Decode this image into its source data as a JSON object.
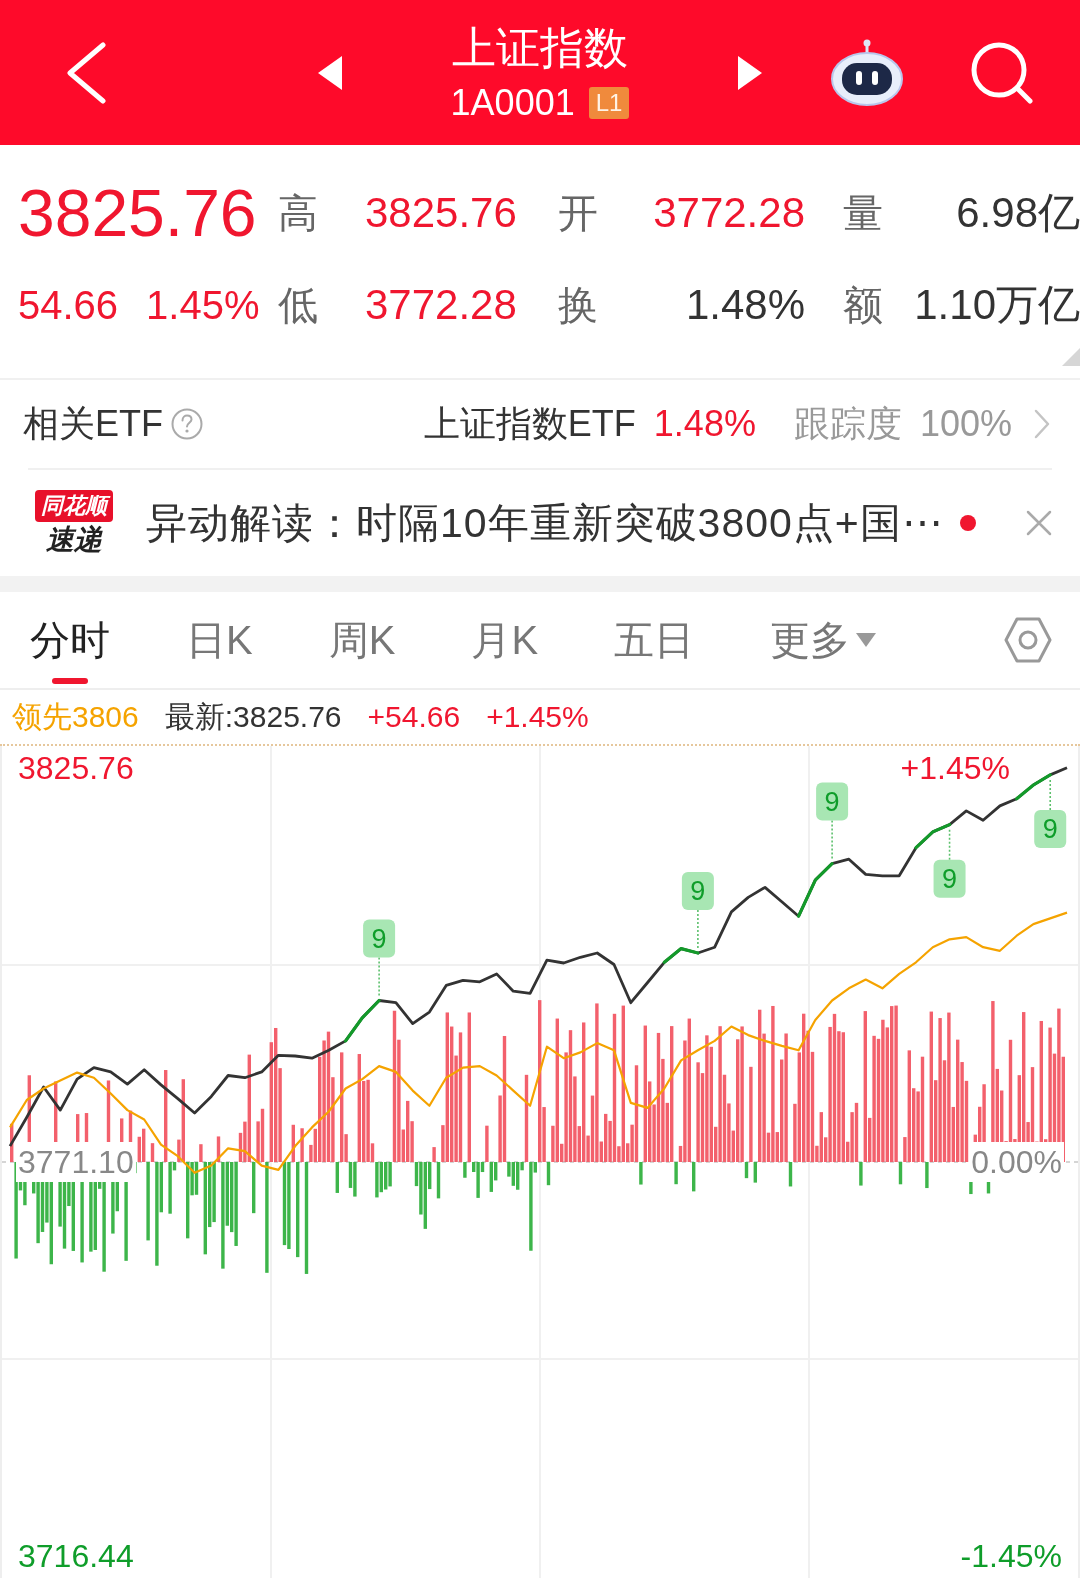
{
  "header": {
    "title": "上证指数",
    "code": "1A0001",
    "badge": "L1"
  },
  "quote": {
    "price": "3825.76",
    "change": "54.66",
    "change_percent": "1.45%",
    "rows": [
      [
        {
          "label": "高",
          "value": "3825.76",
          "kind": "price"
        },
        {
          "label": "开",
          "value": "3772.28",
          "kind": "price"
        },
        {
          "label": "量",
          "value": "6.98亿",
          "kind": "amount"
        }
      ],
      [
        {
          "label": "低",
          "value": "3772.28",
          "kind": "price"
        },
        {
          "label": "换",
          "value": "1.48%",
          "kind": "amount"
        },
        {
          "label": "额",
          "value": "1.10万亿",
          "kind": "amount"
        }
      ]
    ]
  },
  "etf": {
    "label": "相关ETF",
    "name": "上证指数ETF",
    "change": "1.48%",
    "tracking_label": "跟踪度",
    "tracking": "100%"
  },
  "news": {
    "logo_top": "同花顺",
    "logo_bottom": "速递",
    "text": "异动解读：时隔10年重新突破3800点+国⋯",
    "unread": true
  },
  "tabs": [
    {
      "label": "分时",
      "selected": true,
      "kind": "period"
    },
    {
      "label": "日K",
      "selected": false,
      "kind": "period"
    },
    {
      "label": "周K",
      "selected": false,
      "kind": "period"
    },
    {
      "label": "月K",
      "selected": false,
      "kind": "period"
    },
    {
      "label": "五日",
      "selected": false,
      "kind": "period"
    },
    {
      "label": "更多",
      "selected": false,
      "kind": "menu"
    }
  ],
  "summary": {
    "lead": "领先3806",
    "latest": "最新:3825.76",
    "change": "+54.66",
    "change_percent": "+1.45%"
  },
  "chart": {
    "right_labels": [
      "+1.45%",
      "0.00%",
      "-1.45%"
    ],
    "signals": [
      {
        "text": "9"
      },
      {
        "text": "9"
      },
      {
        "text": "9"
      },
      {
        "text": "9"
      },
      {
        "text": "9"
      }
    ],
    "chart_data": {
      "type": "line",
      "ylim": [
        3713.39,
        3828.81
      ],
      "yticks": [
        {
          "value": 3825.76,
          "label": "3825.76"
        },
        {
          "value": 3771.1,
          "label": "3771.10"
        },
        {
          "value": 3716.44,
          "label": "3716.44"
        }
      ],
      "series": [
        {
          "color": "#333333",
          "values": [
            3773.3,
            3777.3,
            3781.5,
            3778.3,
            3782.6,
            3784.2,
            3783.6,
            3781.9,
            3783.9,
            3781.8,
            3779.9,
            3777.9,
            3780.2,
            3783.1,
            3782.8,
            3783.6,
            3785.9,
            3785.8,
            3785.5,
            3786.6,
            3787.9,
            3791.1,
            3793.5,
            3793.2,
            3790.3,
            3791.9,
            3795.6,
            3796.3,
            3796.1,
            3797.2,
            3794.8,
            3794.5,
            3799.1,
            3798.7,
            3799.5,
            3800.1,
            3798.5,
            3793.2,
            3796.0,
            3798.8,
            3800.7,
            3800.1,
            3800.9,
            3805.8,
            3807.8,
            3809.2,
            3807.2,
            3805.2,
            3810.2,
            3812.5,
            3813.1,
            3811.0,
            3810.8,
            3810.8,
            3814.7,
            3816.9,
            3817.9,
            3819.8,
            3818.5,
            3820.5,
            3821.5,
            3823.4,
            3824.8,
            3825.8
          ]
        },
        {
          "color": "#f5a300",
          "values": [
            3775.9,
            3779.7,
            3781.3,
            3782.4,
            3783.5,
            3782.8,
            3780.6,
            3778.3,
            3777.0,
            3773.5,
            3771.9,
            3769.6,
            3770.6,
            3773.0,
            3772.6,
            3770.6,
            3770.0,
            3773.3,
            3775.9,
            3778.1,
            3781.3,
            3782.6,
            3784.4,
            3783.6,
            3781.0,
            3778.9,
            3782.8,
            3784.2,
            3784.4,
            3783.1,
            3781.0,
            3778.9,
            3787.1,
            3785.5,
            3786.3,
            3787.6,
            3786.6,
            3779.3,
            3778.6,
            3781.3,
            3785.2,
            3786.6,
            3787.9,
            3789.9,
            3788.7,
            3787.9,
            3787.2,
            3786.6,
            3790.8,
            3793.5,
            3795.2,
            3796.4,
            3795.2,
            3797.2,
            3798.8,
            3800.9,
            3802.0,
            3802.3,
            3800.9,
            3800.4,
            3802.5,
            3804.1,
            3804.9,
            3805.7
          ]
        }
      ]
    }
  }
}
